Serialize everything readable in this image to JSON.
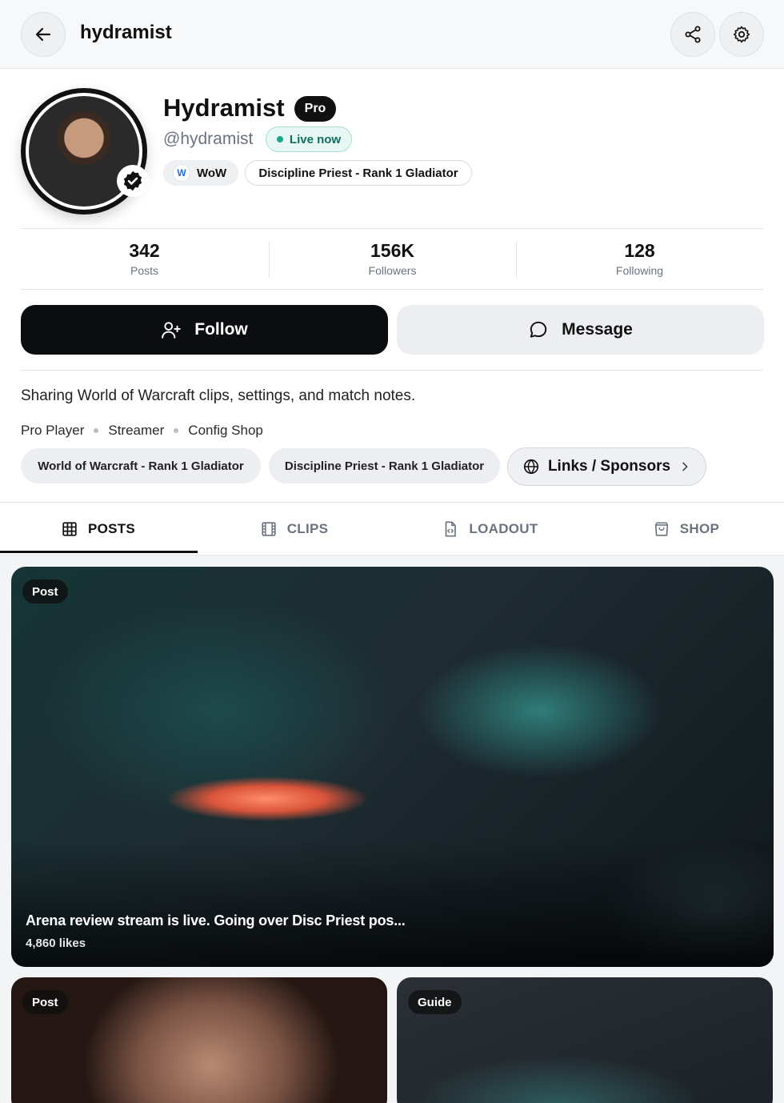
{
  "header": {
    "title": "hydramist",
    "back_icon": "arrow-left-icon",
    "share_icon": "share-icon",
    "settings_icon": "gear-icon"
  },
  "profile": {
    "display_name": "Hydramist",
    "pro_badge": "Pro",
    "handle": "@hydramist",
    "live_status": "Live now",
    "game_chip_initial": "W",
    "game_chip": "WoW",
    "spec_chip": "Discipline Priest - Rank 1 Gladiator",
    "verified_icon": "verified-check-icon"
  },
  "stats": [
    {
      "value": "342",
      "label": "Posts"
    },
    {
      "value": "156K",
      "label": "Followers"
    },
    {
      "value": "128",
      "label": "Following"
    }
  ],
  "actions": {
    "follow_label": "Follow",
    "message_label": "Message"
  },
  "bio": {
    "text": "Sharing World of Warcraft clips, settings, and match notes.",
    "roles": [
      "Pro Player",
      "Streamer",
      "Config Shop"
    ],
    "tags": [
      "World of Warcraft - Rank 1 Gladiator",
      "Discipline Priest - Rank 1 Gladiator"
    ],
    "links_label": "Links / Sponsors"
  },
  "tabs": [
    {
      "label": "POSTS",
      "icon": "grid-icon",
      "active": true
    },
    {
      "label": "CLIPS",
      "icon": "film-icon",
      "active": false
    },
    {
      "label": "LOADOUT",
      "icon": "file-code-icon",
      "active": false
    },
    {
      "label": "SHOP",
      "icon": "shopping-bag-icon",
      "active": false
    }
  ],
  "feed": [
    {
      "badge": "Post",
      "caption": "Arena review stream is live. Going over Disc Priest pos...",
      "likes": "4,860 likes"
    },
    {
      "badge": "Post"
    },
    {
      "badge": "Guide"
    }
  ],
  "colors": {
    "accent_dark": "#0c0d10",
    "live_green": "#1aa68a",
    "muted_text": "#6b7280"
  }
}
